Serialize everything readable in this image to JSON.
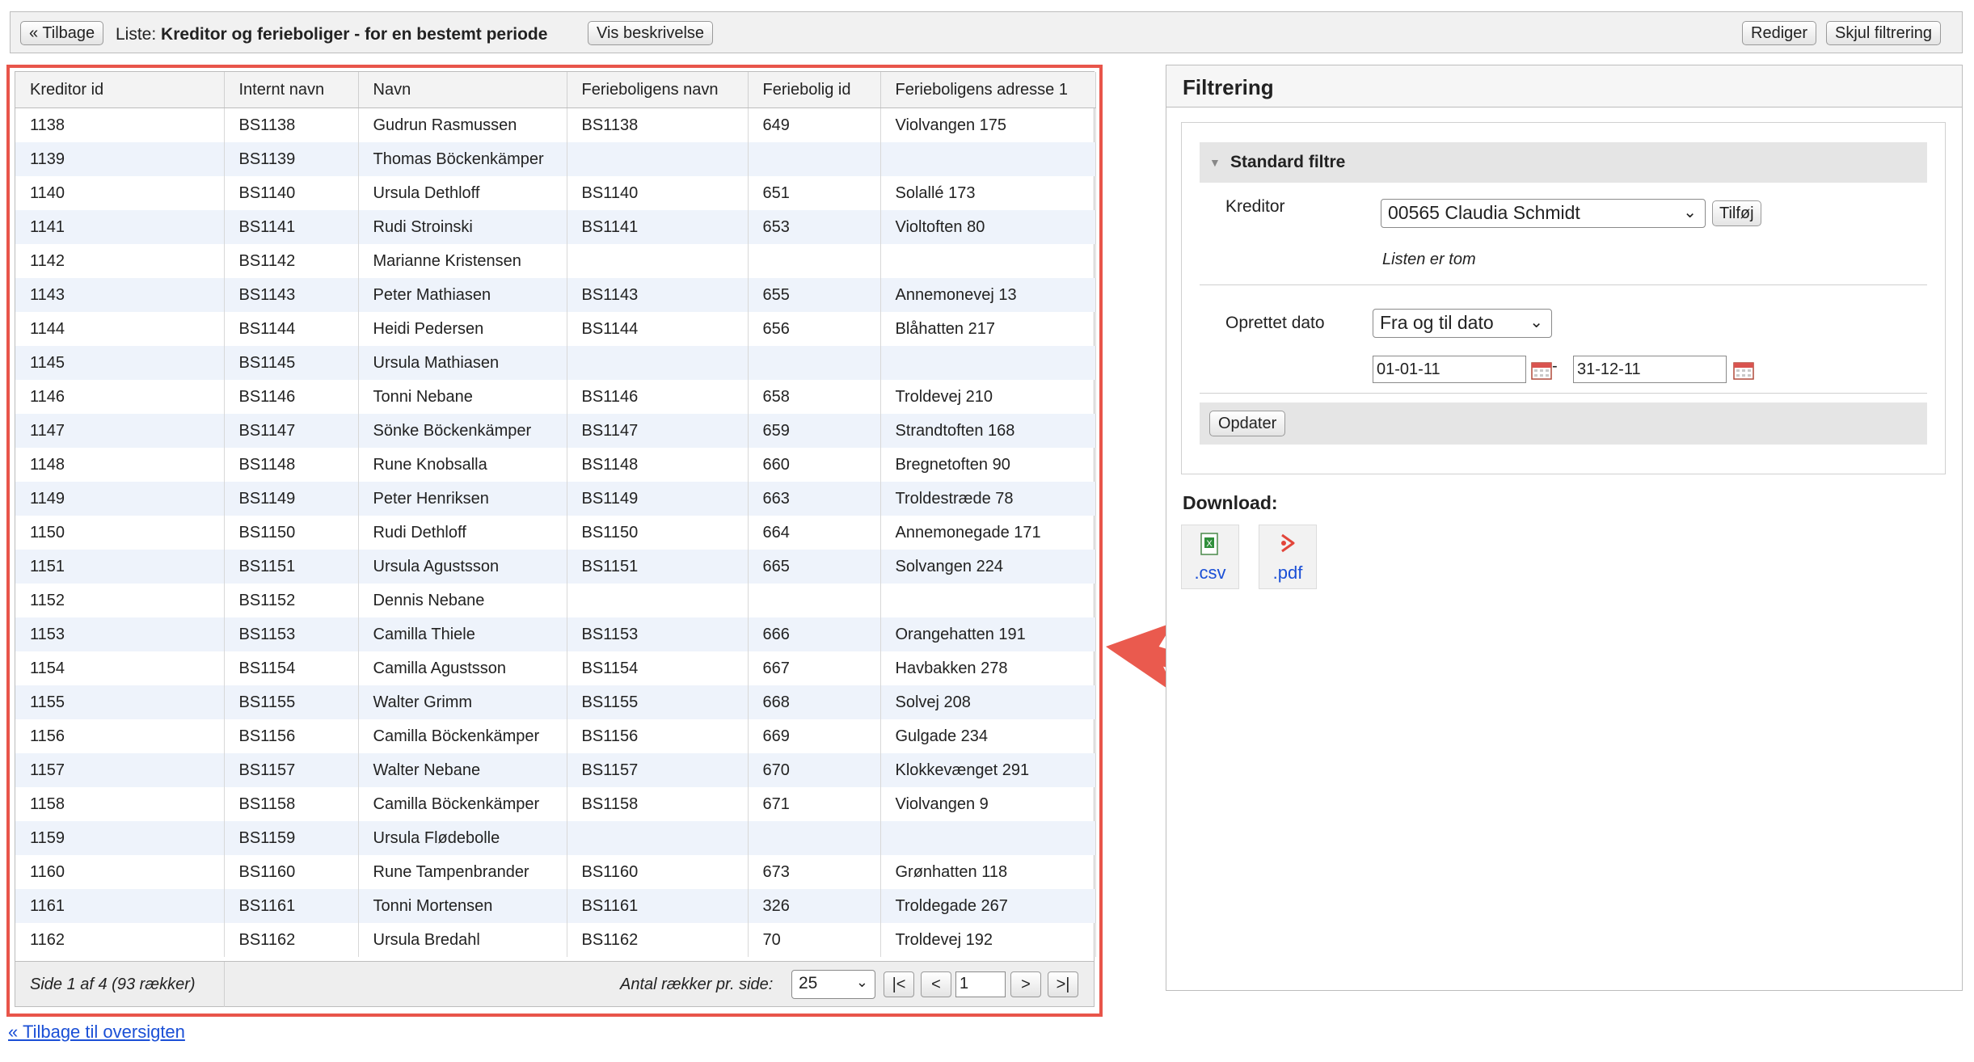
{
  "topbar": {
    "back_label": "« Tilbage",
    "list_prefix": "Liste:",
    "list_title": "Kreditor og ferieboliger - for en bestemt periode",
    "description_label": "Vis beskrivelse",
    "edit_label": "Rediger",
    "hide_filter_label": "Skjul filtrering"
  },
  "table": {
    "columns": [
      "Kreditor id",
      "Internt navn",
      "Navn",
      "Ferieboligens navn",
      "Feriebolig id",
      "Ferieboligens adresse 1"
    ],
    "rows": [
      [
        "1138",
        "BS1138",
        "Gudrun Rasmussen",
        "BS1138",
        "649",
        "Violvangen 175"
      ],
      [
        "1139",
        "BS1139",
        "Thomas Böckenkämper",
        "",
        "",
        ""
      ],
      [
        "1140",
        "BS1140",
        "Ursula Dethloff",
        "BS1140",
        "651",
        "Solallé 173"
      ],
      [
        "1141",
        "BS1141",
        "Rudi Stroinski",
        "BS1141",
        "653",
        "Violtoften 80"
      ],
      [
        "1142",
        "BS1142",
        "Marianne Kristensen",
        "",
        "",
        ""
      ],
      [
        "1143",
        "BS1143",
        "Peter Mathiasen",
        "BS1143",
        "655",
        "Annemonevej 13"
      ],
      [
        "1144",
        "BS1144",
        "Heidi Pedersen",
        "BS1144",
        "656",
        "Blåhatten 217"
      ],
      [
        "1145",
        "BS1145",
        "Ursula Mathiasen",
        "",
        "",
        ""
      ],
      [
        "1146",
        "BS1146",
        "Tonni Nebane",
        "BS1146",
        "658",
        "Troldevej 210"
      ],
      [
        "1147",
        "BS1147",
        "Sönke Böckenkämper",
        "BS1147",
        "659",
        "Strandtoften 168"
      ],
      [
        "1148",
        "BS1148",
        "Rune Knobsalla",
        "BS1148",
        "660",
        "Bregnetoften 90"
      ],
      [
        "1149",
        "BS1149",
        "Peter Henriksen",
        "BS1149",
        "663",
        "Troldestræde 78"
      ],
      [
        "1150",
        "BS1150",
        "Rudi Dethloff",
        "BS1150",
        "664",
        "Annemonegade 171"
      ],
      [
        "1151",
        "BS1151",
        "Ursula Agustsson",
        "BS1151",
        "665",
        "Solvangen 224"
      ],
      [
        "1152",
        "BS1152",
        "Dennis Nebane",
        "",
        "",
        ""
      ],
      [
        "1153",
        "BS1153",
        "Camilla Thiele",
        "BS1153",
        "666",
        "Orangehatten 191"
      ],
      [
        "1154",
        "BS1154",
        "Camilla Agustsson",
        "BS1154",
        "667",
        "Havbakken 278"
      ],
      [
        "1155",
        "BS1155",
        "Walter Grimm",
        "BS1155",
        "668",
        "Solvej 208"
      ],
      [
        "1156",
        "BS1156",
        "Camilla Böckenkämper",
        "BS1156",
        "669",
        "Gulgade 234"
      ],
      [
        "1157",
        "BS1157",
        "Walter Nebane",
        "BS1157",
        "670",
        "Klokkevænget 291"
      ],
      [
        "1158",
        "BS1158",
        "Camilla Böckenkämper",
        "BS1158",
        "671",
        "Violvangen 9"
      ],
      [
        "1159",
        "BS1159",
        "Ursula Flødebolle",
        "",
        "",
        ""
      ],
      [
        "1160",
        "BS1160",
        "Rune Tampenbrander",
        "BS1160",
        "673",
        "Grønhatten 118"
      ],
      [
        "1161",
        "BS1161",
        "Tonni Mortensen",
        "BS1161",
        "326",
        "Troldegade 267"
      ],
      [
        "1162",
        "BS1162",
        "Ursula Bredahl",
        "BS1162",
        "70",
        "Troldevej 192"
      ]
    ],
    "footer": {
      "page_info": "Side 1 af 4 (93 rækker)",
      "rows_per_page_label": "Antal rækker pr. side:",
      "rows_per_page_value": "25",
      "first_label": "|<",
      "prev_label": "<",
      "page_value": "1",
      "next_label": ">",
      "last_label": ">|"
    }
  },
  "bottom_link": "« Tilbage til oversigten",
  "filter": {
    "title": "Filtrering",
    "section_title": "Standard filtre",
    "kreditor_label": "Kreditor",
    "kreditor_value": "00565 Claudia Schmidt",
    "add_label": "Tilføj",
    "empty_note": "Listen er tom",
    "created_label": "Oprettet dato",
    "date_mode_value": "Fra og til dato",
    "date_from": "01-01-11",
    "date_dash": "-",
    "date_to": "31-12-11",
    "update_label": "Opdater",
    "download_label": "Download:",
    "csv_label": ".csv",
    "pdf_label": ".pdf"
  },
  "colors": {
    "highlight_border": "#e8554a",
    "arrow": "#ea5a4e",
    "link": "#1a4fd6",
    "row_alt": "#eef3fb"
  }
}
